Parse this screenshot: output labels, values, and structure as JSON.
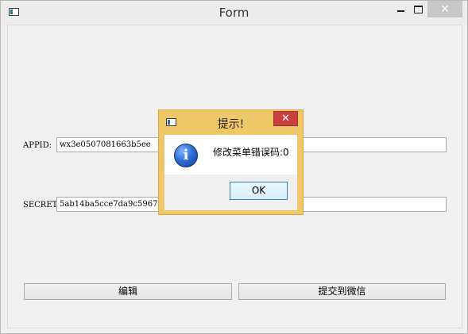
{
  "window": {
    "title": "Form"
  },
  "form": {
    "appid_label": "APPID:",
    "appid_value": "wx3e0507081663b5ee",
    "secret_label": "SECRET",
    "secret_value": "5ab14ba5cce7da9c59676",
    "edit_button": "编辑",
    "submit_button": "提交到微信"
  },
  "dialog": {
    "title": "提示!",
    "message": "修改菜单错误码:0",
    "ok_label": "OK"
  },
  "colors": {
    "dialog_frame": "#eec867",
    "close_button": "#c8413d"
  },
  "icons": {
    "app": "form-app-icon",
    "info": "information-icon"
  }
}
